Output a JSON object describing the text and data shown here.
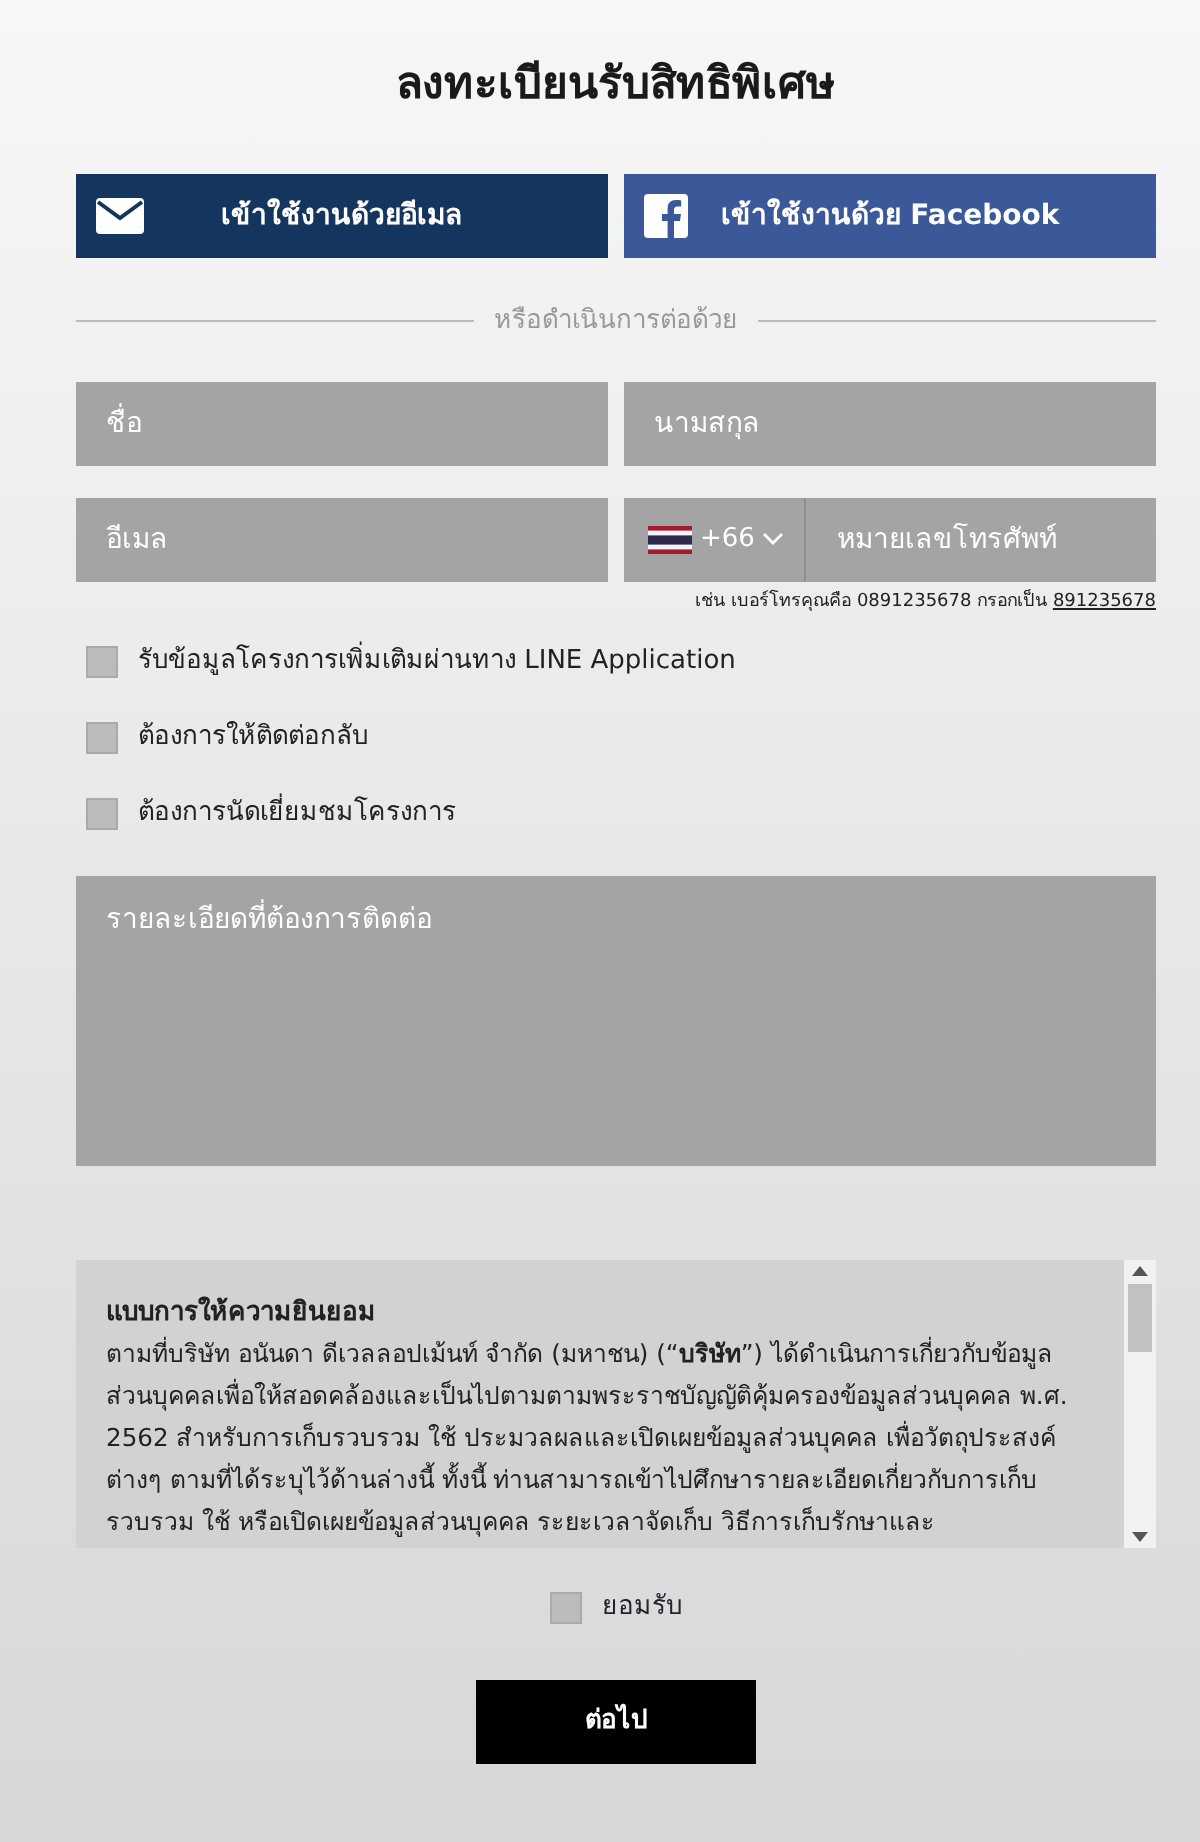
{
  "title": "ลงทะเบียนรับสิทธิพิเศษ",
  "login_buttons": [
    {
      "kind": "email",
      "label": "เข้าใช้งานด้วยอีเมล"
    },
    {
      "kind": "facebook",
      "label": "เข้าใช้งานด้วย Facebook"
    }
  ],
  "divider_text": "หรือดำเนินการต่อด้วย",
  "fields": {
    "first_name": {
      "placeholder": "ชื่อ"
    },
    "last_name": {
      "placeholder": "นามสกุล"
    },
    "email": {
      "placeholder": "อีเมล"
    },
    "phone": {
      "country_code": "+66",
      "placeholder": "หมายเลขโทรศัพท์"
    }
  },
  "phone_hint": {
    "text": "เช่น เบอร์โทรคุณคือ 0891235678 กรอกเป็น",
    "example": "891235678"
  },
  "options": [
    {
      "label": "รับข้อมูลโครงการเพิ่มเติมผ่านทาง LINE Application",
      "checked": false
    },
    {
      "label": "ต้องการให้ติดต่อกลับ",
      "checked": false
    },
    {
      "label": "ต้องการนัดเยี่ยมชมโครงการ",
      "checked": false
    }
  ],
  "details": {
    "placeholder": "รายละเอียดที่ต้องการติดต่อ"
  },
  "consent": {
    "title": "แบบการให้ความยินยอม",
    "text": "ตามที่บริษัท อนันดา ดีเวลลอปเม้นท์ จำกัด (มหาชน) (“**บริษัท**”) ได้ดำเนินการเกี่ยวกับข้อมูลส่วนบุคคลเพื่อให้สอดคล้องและเป็นไปตามตามพระราชบัญญัติคุ้มครองข้อมูลส่วนบุคคล พ.ศ. 2562 สำหรับการเก็บรวบรวม ใช้ ประมวลผลและเปิดเผยข้อมูลส่วนบุคคล เพื่อวัตถุประสงค์ต่างๆ ตามที่ได้ระบุไว้ด้านล่างนี้ ทั้งนี้ ท่านสามารถเข้าไปศึกษารายละเอียดเกี่ยวกับการเก็บรวบรวม ใช้ หรือเปิดเผยข้อมูลส่วนบุคคล ระยะเวลาจัดเก็บ วิธีการเก็บรักษาและ"
  },
  "accept": {
    "label": "ยอมรับ",
    "checked": false
  },
  "next_button": "ต่อไป"
}
